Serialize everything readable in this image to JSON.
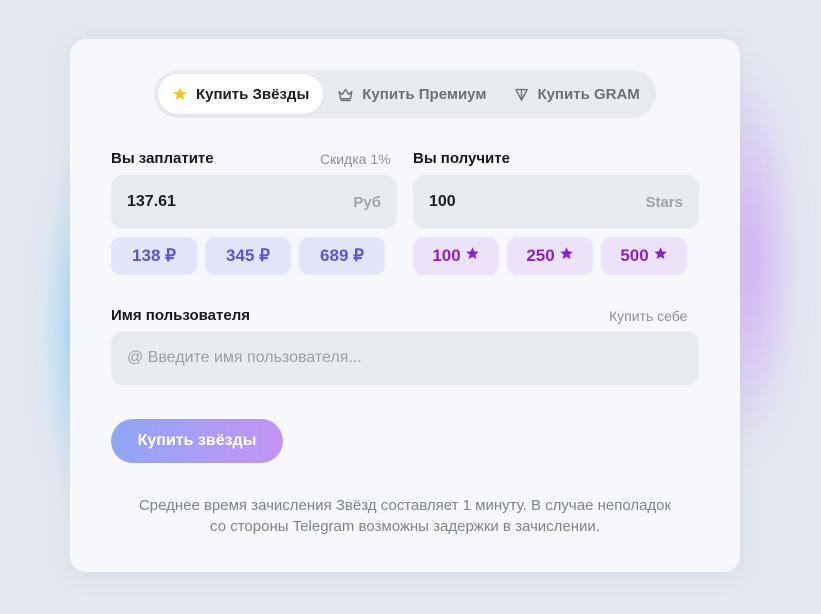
{
  "tabs": [
    {
      "label": "Купить Звёзды",
      "icon": "star-icon",
      "active": true
    },
    {
      "label": "Купить Премиум",
      "icon": "crown-icon",
      "active": false
    },
    {
      "label": "Купить GRAM",
      "icon": "gram-icon",
      "active": false
    }
  ],
  "pay": {
    "label": "Вы заплатите",
    "discount": "Скидка 1%",
    "value": "137.61",
    "unit": "Руб",
    "chips": [
      "138 ₽",
      "345 ₽",
      "689 ₽"
    ]
  },
  "receive": {
    "label": "Вы получите",
    "value": "100",
    "unit": "Stars",
    "chips": [
      "100",
      "250",
      "500"
    ]
  },
  "username": {
    "label": "Имя пользователя",
    "buy_self": "Купить себе",
    "placeholder": "@ Введите имя пользователя..."
  },
  "buy_button": "Купить звёзды",
  "note": "Среднее время зачисления Звёзд составляет 1 минуту. В случае неполадок со стороны Telegram возможны задержки в зачислении.",
  "colors": {
    "accent_star": "#f5c518",
    "rub_chip_text": "#5a55d6",
    "star_chip_text": "#8a22c8",
    "button_gradient_start": "#8fa6f7",
    "button_gradient_end": "#c494f3"
  }
}
